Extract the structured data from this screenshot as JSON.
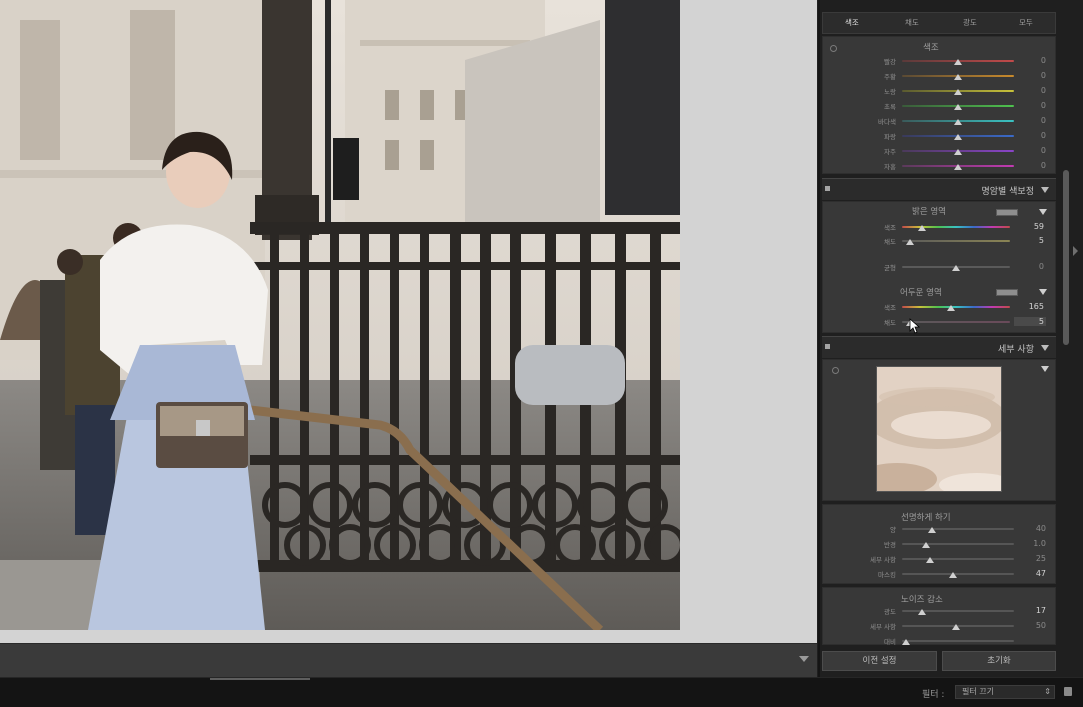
{
  "panel": {
    "tabs": [
      "색조",
      "채도",
      "광도",
      "모두"
    ],
    "hsl": {
      "title": "색조",
      "rows": [
        {
          "label": "빨강",
          "value": "0",
          "gradient": [
            "#5a3a3a",
            "#c24a4a"
          ]
        },
        {
          "label": "주황",
          "value": "0",
          "gradient": [
            "#5a4a34",
            "#c88a2c"
          ]
        },
        {
          "label": "노랑",
          "value": "0",
          "gradient": [
            "#5a5a30",
            "#c8c23a"
          ]
        },
        {
          "label": "초록",
          "value": "0",
          "gradient": [
            "#3a5a3a",
            "#4ec24e"
          ]
        },
        {
          "label": "바다색",
          "value": "0",
          "gradient": [
            "#3a5a5a",
            "#3ac2c2"
          ]
        },
        {
          "label": "파랑",
          "value": "0",
          "gradient": [
            "#3a3a5a",
            "#3a6ac8"
          ]
        },
        {
          "label": "자주",
          "value": "0",
          "gradient": [
            "#4a3a5a",
            "#8a44c8"
          ]
        },
        {
          "label": "자홍",
          "value": "0",
          "gradient": [
            "#5a3a5a",
            "#c23ab2"
          ]
        }
      ]
    },
    "split_toning": {
      "title": "명암별 색보정",
      "highlights_title": "밝은 영역",
      "highlights_hue_label": "색조",
      "highlights_hue_value": "59",
      "highlights_sat_label": "채도",
      "highlights_sat_value": "5",
      "balance_label": "균형",
      "balance_value": "0",
      "shadows_title": "어두운 영역",
      "shadows_hue_label": "색조",
      "shadows_hue_value": "165",
      "shadows_sat_label": "채도",
      "shadows_sat_value": "5"
    },
    "detail": {
      "title": "세부 사항",
      "sharpening_title": "선명하게 하기",
      "sharpening": [
        {
          "label": "양",
          "value": "40"
        },
        {
          "label": "반경",
          "value": "1.0"
        },
        {
          "label": "세부 사항",
          "value": "25"
        },
        {
          "label": "마스킹",
          "value": "47"
        }
      ],
      "noise_title": "노이즈 감소",
      "noise": [
        {
          "label": "광도",
          "value": "17"
        },
        {
          "label": "세부 사항",
          "value": "50"
        },
        {
          "label": "대비",
          "value": ""
        }
      ]
    },
    "buttons": {
      "previous": "이전 설정",
      "reset": "초기화"
    }
  },
  "statusbar": {
    "filter_label": "필터 :",
    "filter_value": "필터 끄기"
  },
  "colors": {
    "panel_bg": "#383838",
    "accent": "#d0d0d0"
  }
}
